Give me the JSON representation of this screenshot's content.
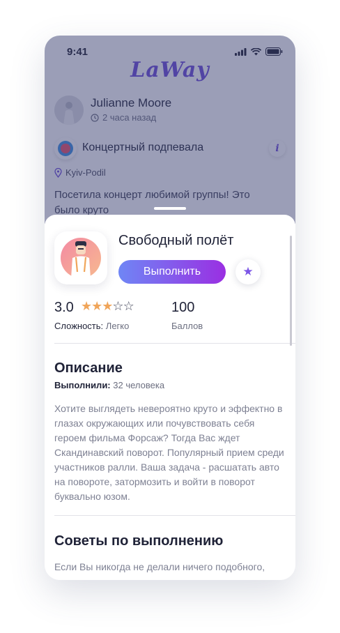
{
  "status_bar": {
    "time": "9:41"
  },
  "app": {
    "logo": "LaWay"
  },
  "post": {
    "author": "Julianne Moore",
    "time_ago": "2 часа назад",
    "task_name": "Концертный подпевала",
    "info_label": "i",
    "location": "Kyiv-Podil",
    "text": "Посетила концерт любимой группы! Это было круто"
  },
  "task": {
    "title": "Свободный полёт",
    "action_label": "Выполнить",
    "rating": "3.0",
    "stars": {
      "filled": 3,
      "total": 5
    },
    "difficulty_label": "Сложность:",
    "difficulty_value": "Легко",
    "points": "100",
    "points_label": "Баллов",
    "description_title": "Описание",
    "done_label": "Выполнили:",
    "done_value": "32 человека",
    "description": "Хотите выглядеть невероятно круто и эффектно в глазах окружающих или почувствовать себя героем фильма Форсаж? Тогда Вас ждет Скандинавский поворот. Популярный прием среди участников ралли. Ваша задача - расшатать авто на повороте, затормозить и войти в поворот буквально юзом.",
    "tips_title": "Советы по выполнению",
    "tips_text": "Если Вы никогда не делали ничего подобного,"
  },
  "colors": {
    "accent": "#6b4ad8",
    "button_gradient_start": "#6f86f5",
    "button_gradient_end": "#9a2fe2",
    "star_filled": "#f0a55a",
    "overlay": "#373e70"
  }
}
